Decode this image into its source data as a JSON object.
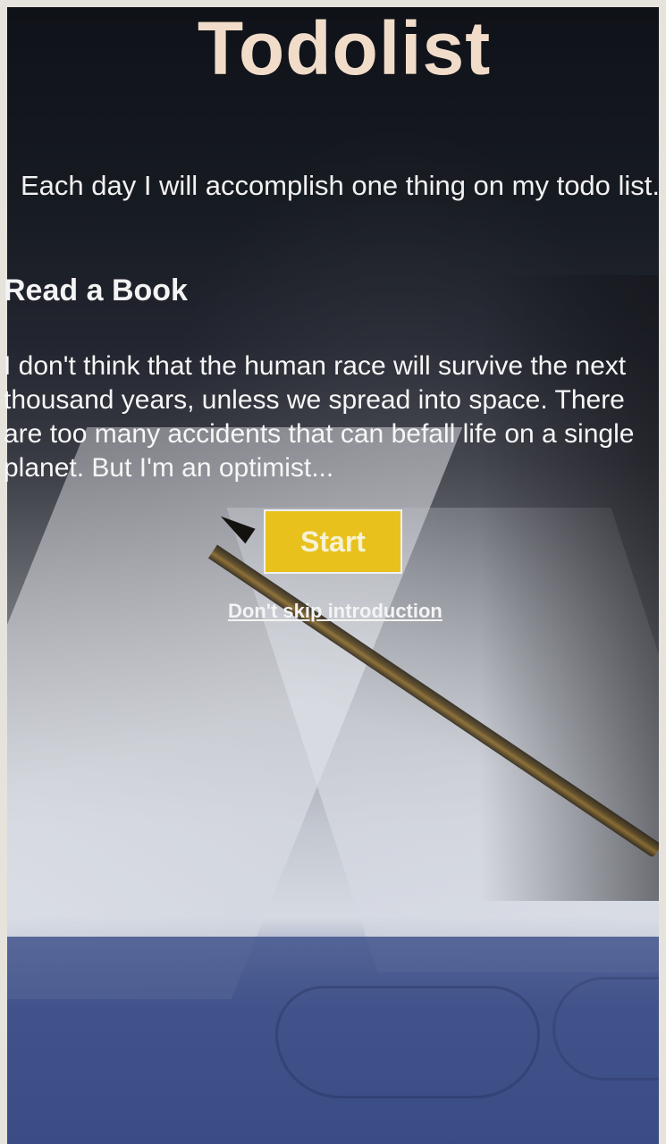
{
  "app": {
    "title": "Todolist",
    "tagline": "Each day I will accomplish one thing on my todo list."
  },
  "task": {
    "heading": "Read a Book",
    "quote": "I don't think that the human race will survive the next thousand years, unless we spread into space. There are too many accidents that can befall life on a single planet. But I'm an optimist..."
  },
  "actions": {
    "start_label": "Start",
    "skip_link_label": "Don't skip introduction"
  },
  "colors": {
    "button_accent": "#e9c11d",
    "title_color": "#f1dcc9"
  },
  "background": {
    "icon": "book-pencil-glasses-photo"
  }
}
